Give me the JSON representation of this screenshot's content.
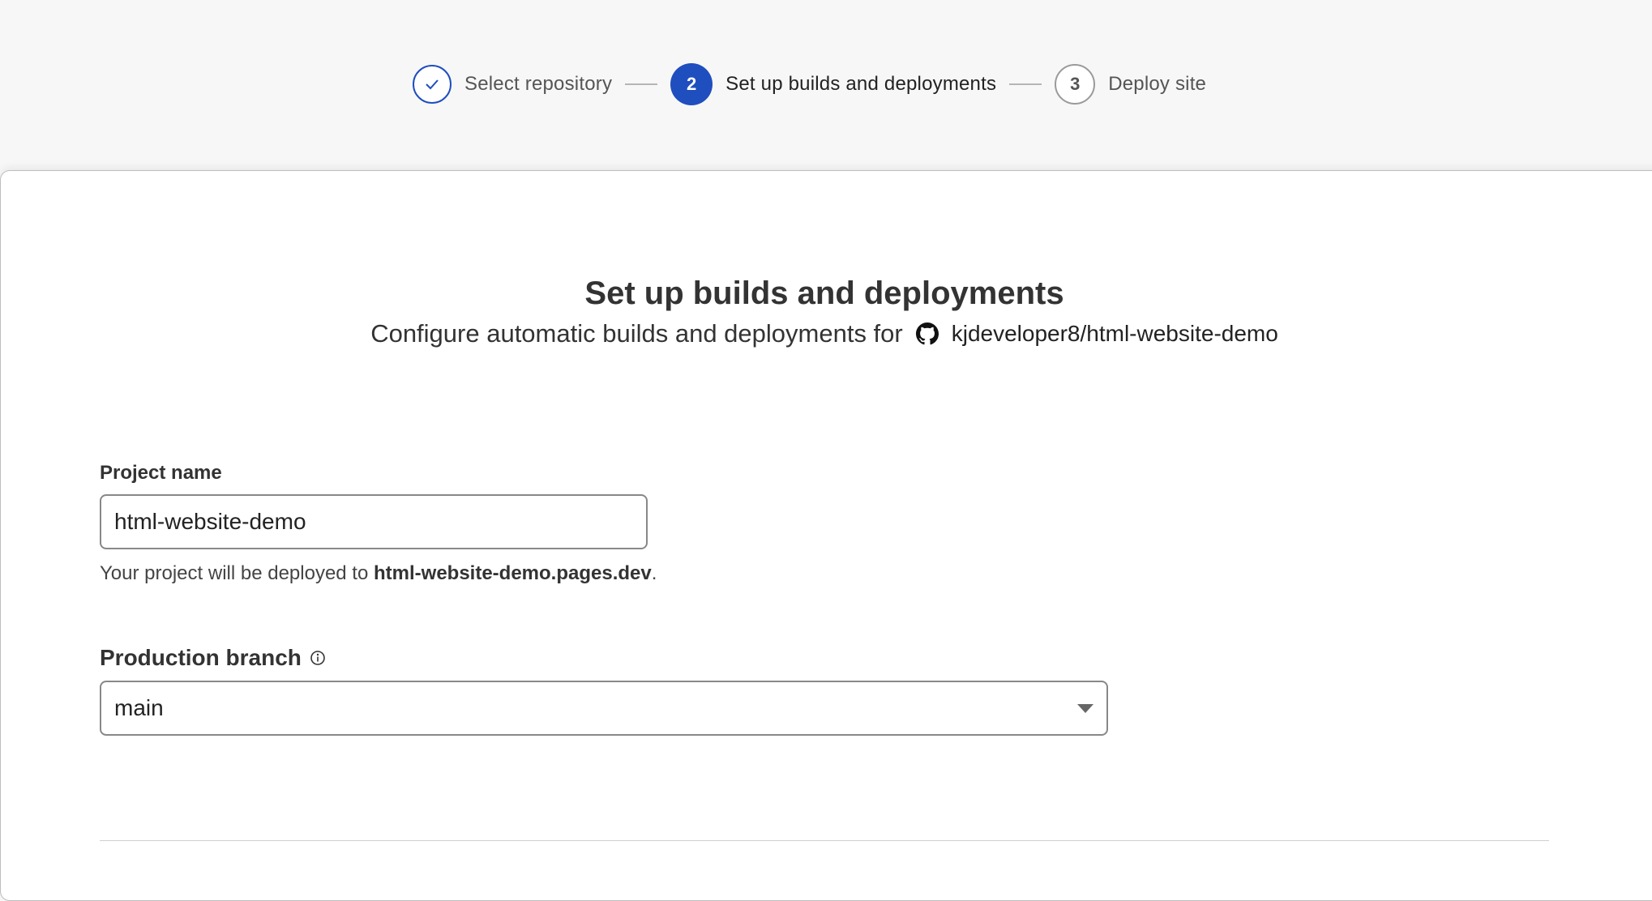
{
  "stepper": {
    "steps": [
      {
        "number": "",
        "label": "Select repository",
        "state": "done",
        "icon": "check-icon"
      },
      {
        "number": "2",
        "label": "Set up builds and deployments",
        "state": "active"
      },
      {
        "number": "3",
        "label": "Deploy site",
        "state": "todo"
      }
    ]
  },
  "header": {
    "title": "Set up builds and deployments",
    "subtitle_prefix": "Configure automatic builds and deployments for",
    "repo_icon": "github-icon",
    "repo_name": "kjdeveloper8/html-website-demo"
  },
  "project_name": {
    "label": "Project name",
    "value": "html-website-demo",
    "helper_prefix": "Your project will be deployed to",
    "helper_domain": "html-website-demo.pages.dev",
    "helper_suffix": "."
  },
  "production_branch": {
    "label": "Production branch",
    "info_icon": "info-icon",
    "selected": "main"
  },
  "colors": {
    "accent": "#1f4ebf",
    "text": "#333333",
    "border": "#888888"
  }
}
